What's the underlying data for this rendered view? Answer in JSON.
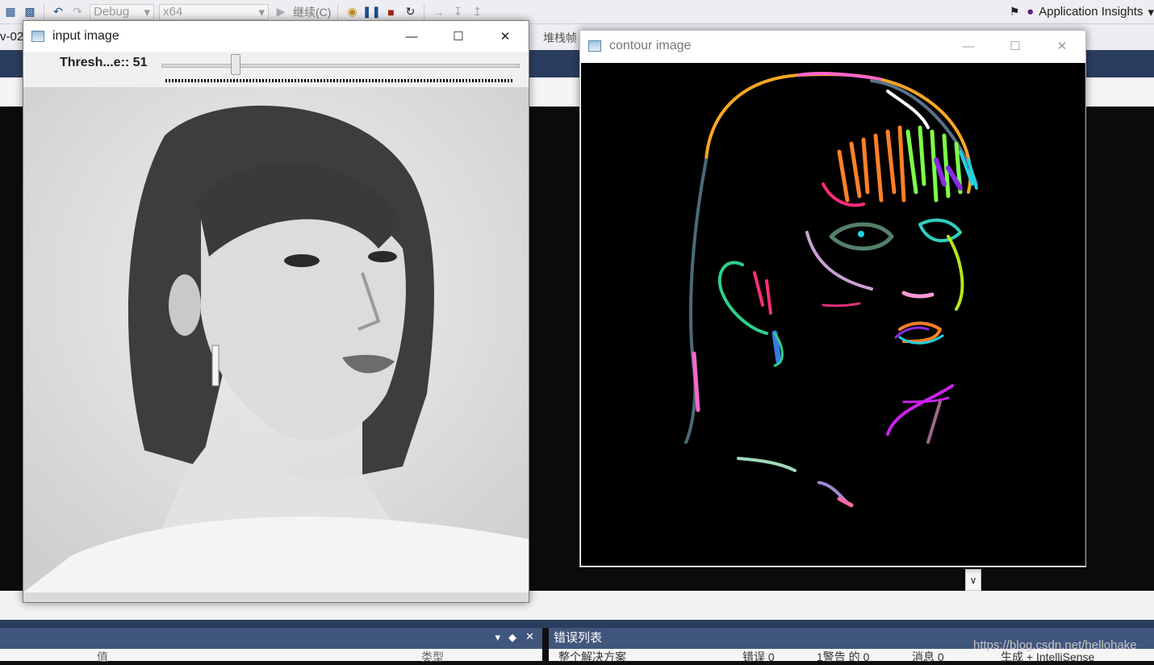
{
  "toolbar": {
    "config": "Debug",
    "platform": "x64",
    "continue_label": "继续(C)",
    "insights_label": "Application Insights"
  },
  "background_tabs": {
    "left_tab": "v-02",
    "stack_frame": "堆栈帧"
  },
  "input_window": {
    "title": "input image",
    "trackbar_label": "Thresh...e:: 51",
    "threshold_value": 51
  },
  "contour_window": {
    "title": "contour image"
  },
  "bottom_panels": {
    "left_col_value": "值",
    "left_col_type": "类型",
    "error_list_title": "错误列表",
    "scope": "整个解决方案",
    "errors": "错误 0",
    "warnings": "1警告 的 0",
    "messages": "消息 0",
    "build": "生成 + IntelliSense"
  },
  "watermark": "https://blog.csdn.net/hellohake",
  "colors": {
    "vs_dark_blue": "#2b3d5e",
    "panel_head": "#41567c",
    "contour_bg": "#000000"
  }
}
